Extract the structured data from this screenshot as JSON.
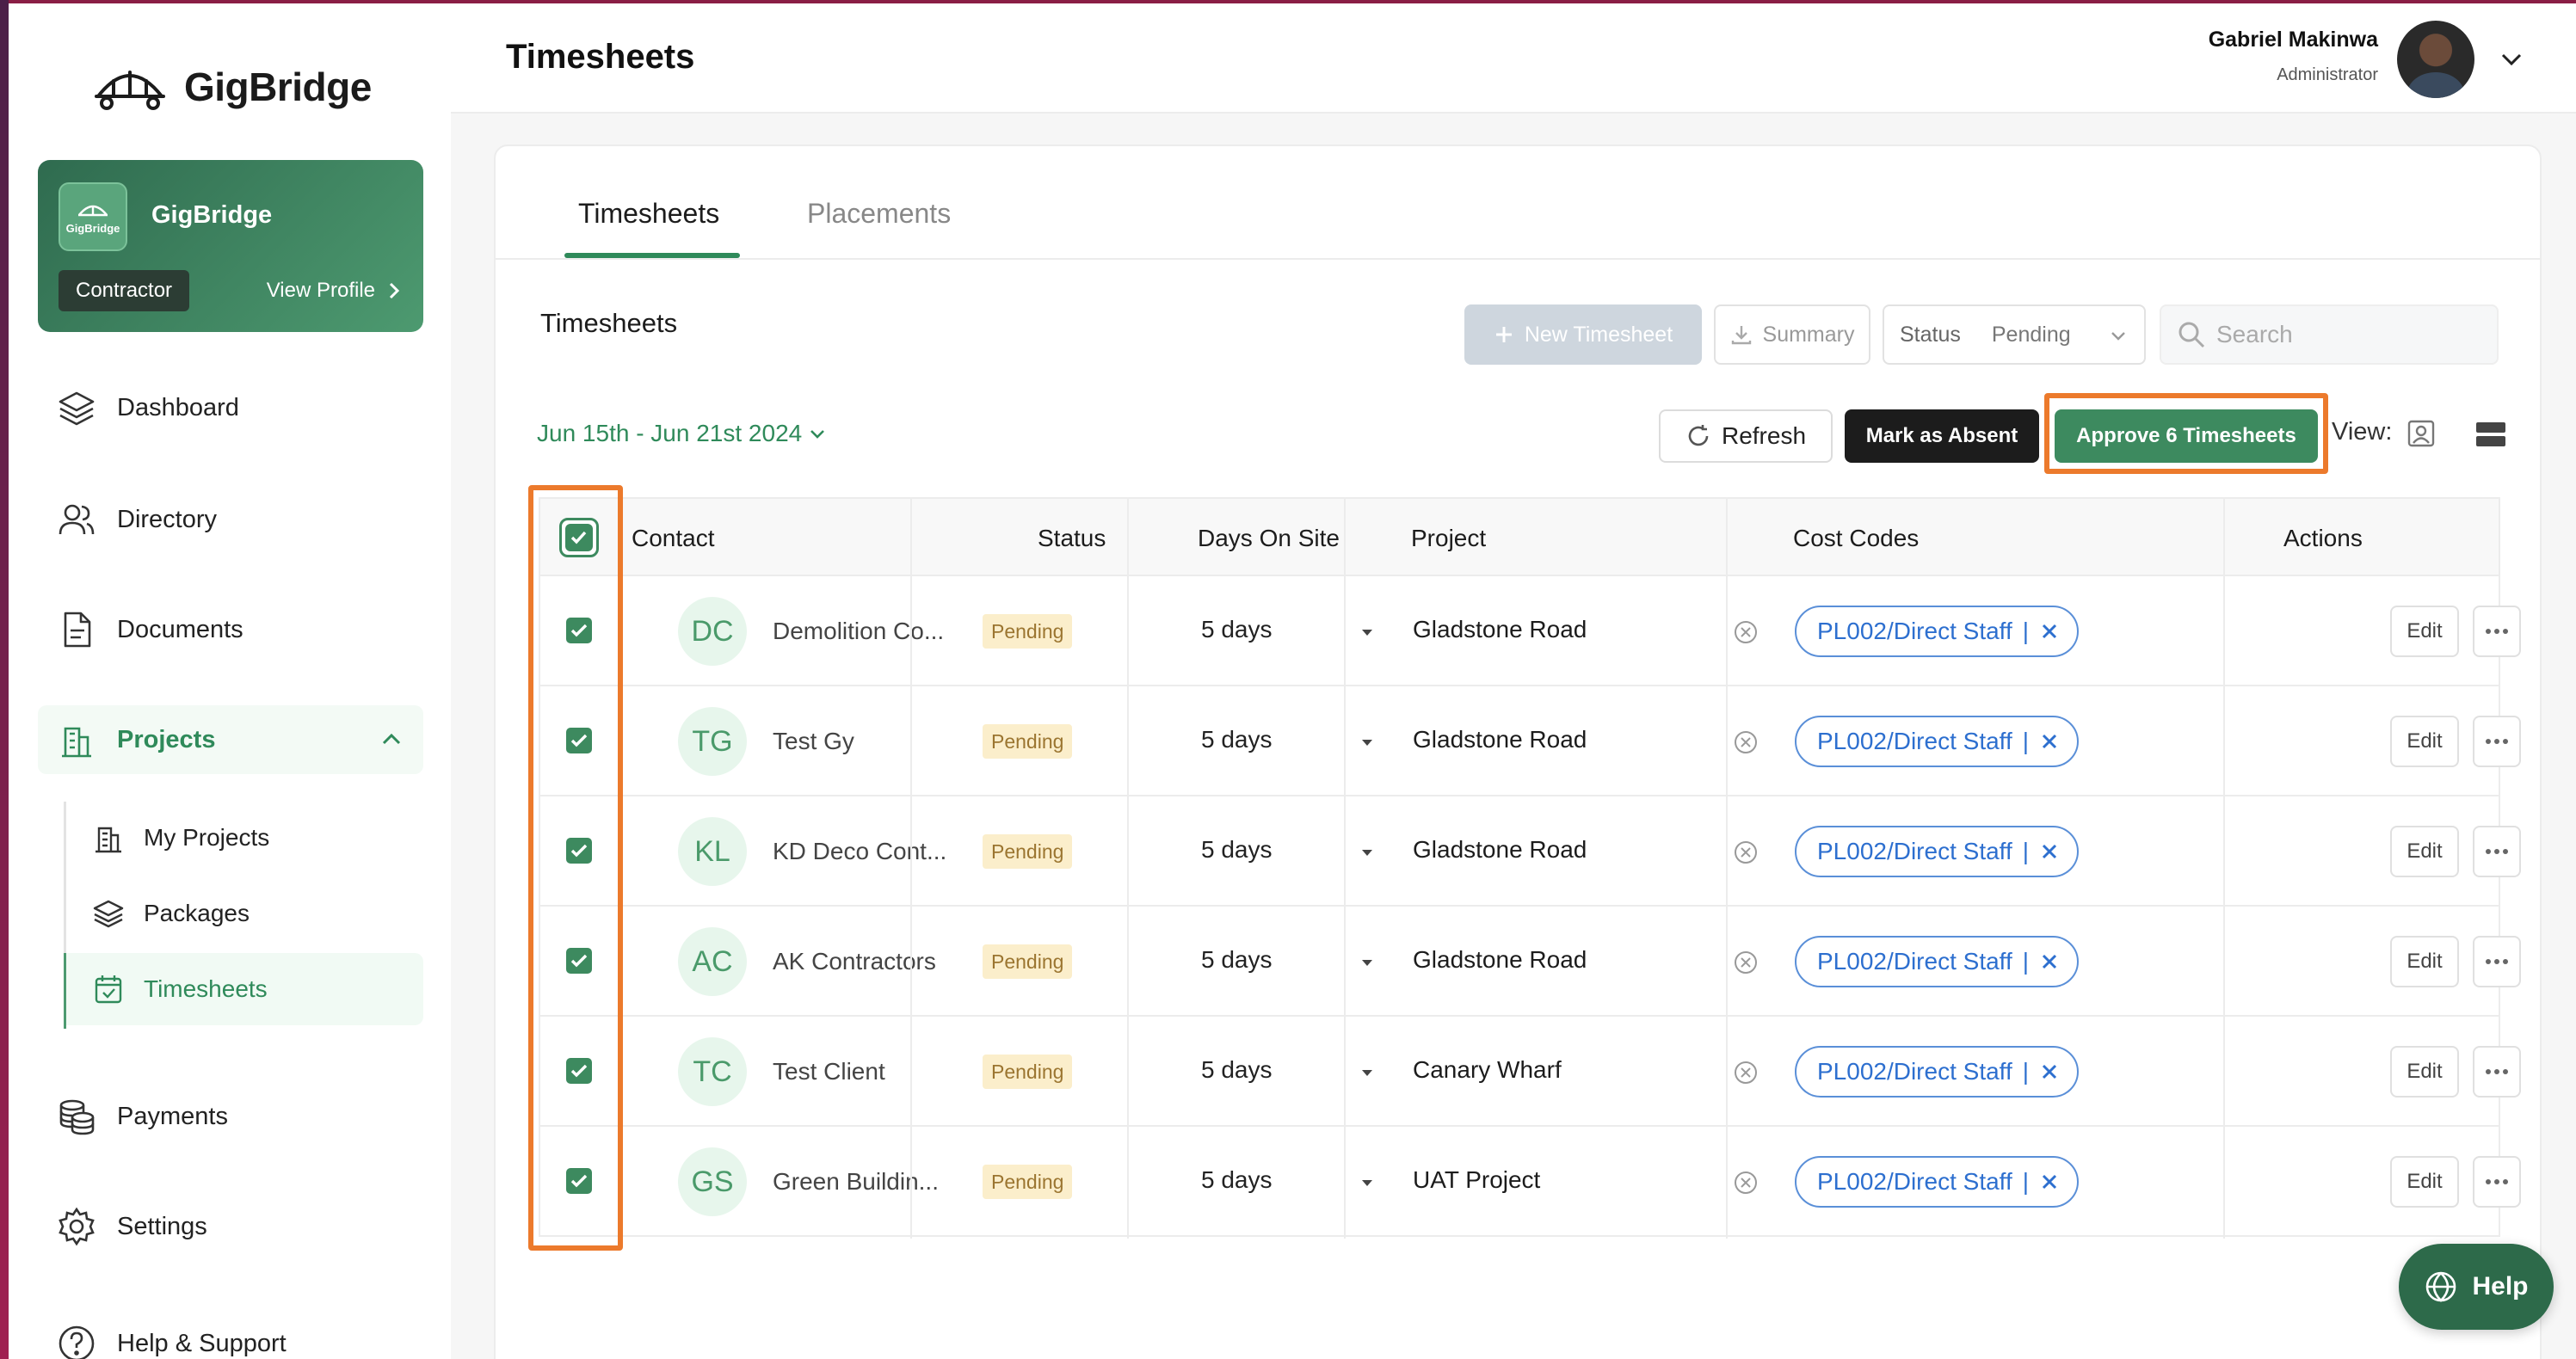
{
  "brand": {
    "name": "GigBridge",
    "accent": "#3d8a5f",
    "highlight": "#ec7a2c"
  },
  "org_card": {
    "logo_text": "GigBridge",
    "name": "GigBridge",
    "role": "Contractor",
    "view_profile": "View Profile"
  },
  "nav": {
    "dashboard": "Dashboard",
    "directory": "Directory",
    "documents": "Documents",
    "projects": "Projects",
    "my_projects": "My Projects",
    "packages": "Packages",
    "timesheets": "Timesheets",
    "payments": "Payments",
    "settings": "Settings",
    "help_support": "Help & Support"
  },
  "header": {
    "title": "Timesheets",
    "user_name": "Gabriel Makinwa",
    "user_role": "Administrator"
  },
  "tabs": {
    "timesheets": "Timesheets",
    "placements": "Placements"
  },
  "section_title": "Timesheets",
  "toolbar": {
    "new_timesheet": "New Timesheet",
    "summary": "Summary",
    "status_label": "Status",
    "status_value": "Pending",
    "search_placeholder": "Search",
    "date_range": "Jun 15th - Jun 21st 2024",
    "refresh": "Refresh",
    "mark_absent": "Mark as Absent",
    "approve": "Approve 6 Timesheets",
    "view_label": "View:"
  },
  "table": {
    "headers": {
      "contact": "Contact",
      "status": "Status",
      "days": "Days On Site",
      "project": "Project",
      "cost_codes": "Cost Codes",
      "actions": "Actions"
    },
    "rows": [
      {
        "initials": "DC",
        "contact": "Demolition Co...",
        "status": "Pending",
        "days": "5 days",
        "project": "Gladstone Road",
        "cost_code": "PL002/Direct Staff",
        "edit": "Edit"
      },
      {
        "initials": "TG",
        "contact": "Test Gy",
        "status": "Pending",
        "days": "5 days",
        "project": "Gladstone Road",
        "cost_code": "PL002/Direct Staff",
        "edit": "Edit"
      },
      {
        "initials": "KL",
        "contact": "KD Deco Cont...",
        "status": "Pending",
        "days": "5 days",
        "project": "Gladstone Road",
        "cost_code": "PL002/Direct Staff",
        "edit": "Edit"
      },
      {
        "initials": "AC",
        "contact": "AK Contractors",
        "status": "Pending",
        "days": "5 days",
        "project": "Gladstone Road",
        "cost_code": "PL002/Direct Staff",
        "edit": "Edit"
      },
      {
        "initials": "TC",
        "contact": "Test Client",
        "status": "Pending",
        "days": "5 days",
        "project": "Canary Wharf",
        "cost_code": "PL002/Direct Staff",
        "edit": "Edit"
      },
      {
        "initials": "GS",
        "contact": "Green Buildin...",
        "status": "Pending",
        "days": "5 days",
        "project": "UAT Project",
        "cost_code": "PL002/Direct Staff",
        "edit": "Edit"
      }
    ]
  },
  "help_button": "Help"
}
